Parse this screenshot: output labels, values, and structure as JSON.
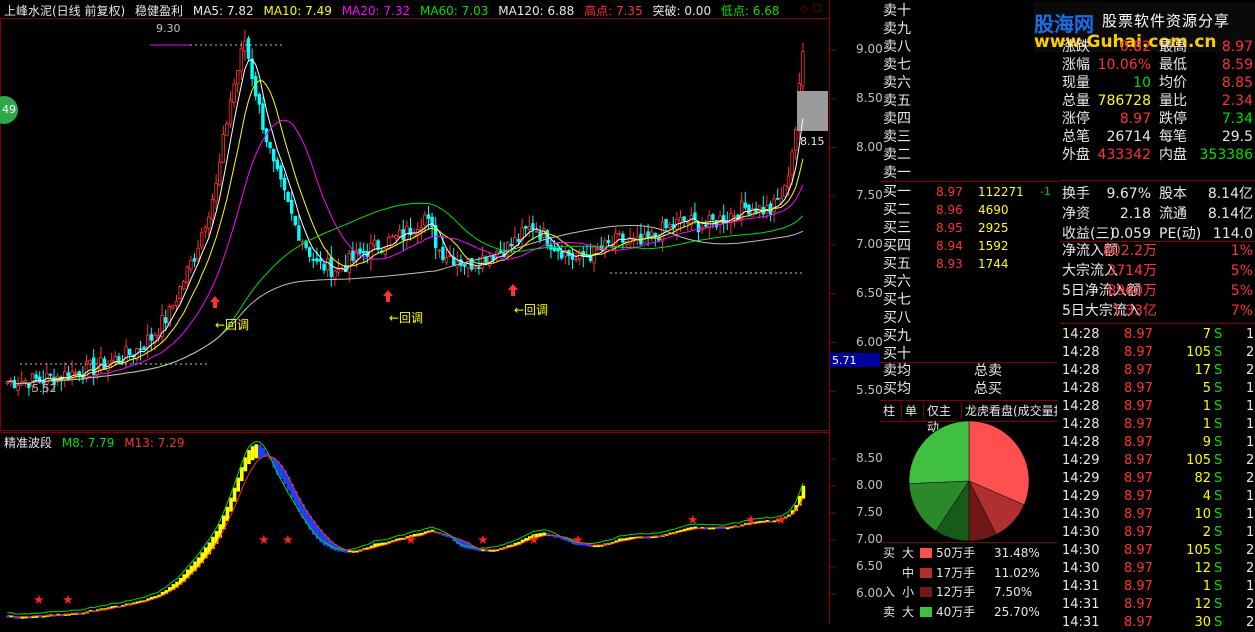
{
  "header": {
    "stock": "上峰水泥(日线 前复权)",
    "formula": "稳健盈利",
    "ma5": "MA5: 7.82",
    "ma10": "MA10: 7.49",
    "ma20": "MA20: 7.32",
    "ma60": "MA60: 7.03",
    "ma120": "MA120: 6.88",
    "high": "高点: 7.35",
    "breakout": "突破: 0.00",
    "low": "低点: 6.68",
    "badge": "49"
  },
  "colors": {
    "up": "#ff3232",
    "down": "#00ffff",
    "ma5": "#ffffff",
    "ma10": "#ffff00",
    "ma20": "#ff00ff",
    "ma60": "#00e000",
    "ma120": "#c0c0c0"
  },
  "main_axis": [
    "9.00",
    "8.50",
    "8.00",
    "7.50",
    "7.00",
    "6.50",
    "6.00",
    "5.50"
  ],
  "annotations": {
    "top": "9.30",
    "bottom": "5.52",
    "pullback": "←回调",
    "price_tag": "8.15",
    "low_tag": "5.71"
  },
  "sub": {
    "title": "精准波段",
    "m8": "M8: 7.79",
    "m13": "M13: 7.29",
    "axis": [
      "8.50",
      "8.00",
      "7.50",
      "7.00",
      "6.50",
      "6.00"
    ]
  },
  "order_book": {
    "asks": [
      "卖十",
      "卖九",
      "卖八",
      "卖七",
      "卖六",
      "卖五",
      "卖四",
      "卖三",
      "卖二",
      "卖一"
    ],
    "bids": [
      {
        "label": "买一",
        "price": "8.97",
        "vol": "112271",
        "chg": "-1"
      },
      {
        "label": "买二",
        "price": "8.96",
        "vol": "4690",
        "chg": ""
      },
      {
        "label": "买三",
        "price": "8.95",
        "vol": "2925",
        "chg": ""
      },
      {
        "label": "买四",
        "price": "8.94",
        "vol": "1592",
        "chg": ""
      },
      {
        "label": "买五",
        "price": "8.93",
        "vol": "1744",
        "chg": ""
      },
      {
        "label": "买六",
        "price": "",
        "vol": "",
        "chg": ""
      },
      {
        "label": "买七",
        "price": "",
        "vol": "",
        "chg": ""
      },
      {
        "label": "买八",
        "price": "",
        "vol": "",
        "chg": ""
      },
      {
        "label": "买九",
        "price": "",
        "vol": "",
        "chg": ""
      },
      {
        "label": "买十",
        "price": "",
        "vol": "",
        "chg": ""
      }
    ],
    "avg_sell": "卖均",
    "avg_buy": "买均",
    "total_sell": "总卖",
    "total_buy": "总买"
  },
  "logo": {
    "name": "股海网",
    "slogan": "股票软件资源分享",
    "url": "www.Guhai.com.cn"
  },
  "quote": [
    {
      "a": "涨跌",
      "av": "0.82",
      "ac": "red",
      "b": "最高",
      "bv": "8.97",
      "bc": "red"
    },
    {
      "a": "涨幅",
      "av": "10.06%",
      "ac": "red",
      "b": "最低",
      "bv": "8.59",
      "bc": "red"
    },
    {
      "a": "现量",
      "av": "10",
      "ac": "grn",
      "b": "均价",
      "bv": "8.85",
      "bc": "red"
    },
    {
      "a": "总量",
      "av": "786728",
      "ac": "yel",
      "b": "量比",
      "bv": "2.34",
      "bc": "red"
    },
    {
      "a": "涨停",
      "av": "8.97",
      "ac": "red",
      "b": "跌停",
      "bv": "7.34",
      "bc": "grn"
    },
    {
      "a": "总笔",
      "av": "26714",
      "ac": "wht",
      "b": "每笔",
      "bv": "29.5",
      "bc": "wht"
    },
    {
      "a": "外盘",
      "av": "433342",
      "ac": "red",
      "b": "内盘",
      "bv": "353386",
      "bc": "grn"
    },
    {
      "a": "换手",
      "av": "9.67%",
      "ac": "wht",
      "b": "股本",
      "bv": "8.14亿",
      "bc": "wht"
    },
    {
      "a": "净资",
      "av": "2.18",
      "ac": "wht",
      "b": "流通",
      "bv": "8.14亿",
      "bc": "wht"
    },
    {
      "a": "收益(三)",
      "av": "0.059",
      "ac": "wht",
      "b": "PE(动)",
      "bv": "114.0",
      "bc": "wht"
    },
    {
      "a": "净流入额",
      "av": "802.2万",
      "ac": "red",
      "b": "",
      "bv": "1%",
      "bc": "red"
    },
    {
      "a": "大宗流入",
      "av": "3714万",
      "ac": "red",
      "b": "",
      "bv": "5%",
      "bc": "red"
    },
    {
      "a": "5日净流入额",
      "av": "8960万",
      "ac": "red",
      "b": "",
      "bv": "5%",
      "bc": "red"
    },
    {
      "a": "5日大宗流入",
      "av": "1.33亿",
      "ac": "red",
      "b": "",
      "bv": "7%",
      "bc": "red"
    }
  ],
  "trades": [
    {
      "t": "14:28",
      "p": "8.97",
      "v": "7",
      "s": "S",
      "c": "1"
    },
    {
      "t": "14:28",
      "p": "8.97",
      "v": "105",
      "s": "S",
      "c": "2"
    },
    {
      "t": "14:28",
      "p": "8.97",
      "v": "17",
      "s": "S",
      "c": "2"
    },
    {
      "t": "14:28",
      "p": "8.97",
      "v": "5",
      "s": "S",
      "c": "1"
    },
    {
      "t": "14:28",
      "p": "8.97",
      "v": "1",
      "s": "S",
      "c": "1"
    },
    {
      "t": "14:28",
      "p": "8.97",
      "v": "1",
      "s": "S",
      "c": "1"
    },
    {
      "t": "14:28",
      "p": "8.97",
      "v": "9",
      "s": "S",
      "c": "1"
    },
    {
      "t": "14:29",
      "p": "8.97",
      "v": "105",
      "s": "S",
      "c": "2"
    },
    {
      "t": "14:29",
      "p": "8.97",
      "v": "82",
      "s": "S",
      "c": "2"
    },
    {
      "t": "14:29",
      "p": "8.97",
      "v": "4",
      "s": "S",
      "c": "1"
    },
    {
      "t": "14:30",
      "p": "8.97",
      "v": "10",
      "s": "S",
      "c": "1"
    },
    {
      "t": "14:30",
      "p": "8.97",
      "v": "2",
      "s": "S",
      "c": "1"
    },
    {
      "t": "14:30",
      "p": "8.97",
      "v": "105",
      "s": "S",
      "c": "2"
    },
    {
      "t": "14:30",
      "p": "8.97",
      "v": "12",
      "s": "S",
      "c": "2"
    },
    {
      "t": "14:31",
      "p": "8.97",
      "v": "1",
      "s": "S",
      "c": "1"
    },
    {
      "t": "14:31",
      "p": "8.97",
      "v": "12",
      "s": "S",
      "c": "2"
    },
    {
      "t": "14:31",
      "p": "8.97",
      "v": "30",
      "s": "S",
      "c": "2"
    }
  ],
  "tabs": [
    "柱",
    "单",
    "仅主动",
    "龙虎看盘(成交量按"
  ],
  "flow": {
    "buy_side": "买",
    "sell_side": "卖",
    "entry": "入",
    "rows": [
      {
        "side": "买",
        "size": "大",
        "color": "#ff5050",
        "amount": "50万手",
        "pct": "31.48%"
      },
      {
        "side": "",
        "size": "中",
        "color": "#b03030",
        "amount": "17万手",
        "pct": "11.02%"
      },
      {
        "side": "入",
        "size": "小",
        "color": "#701818",
        "amount": "12万手",
        "pct": "7.50%"
      },
      {
        "side": "卖",
        "size": "大",
        "color": "#40c040",
        "amount": "40万手",
        "pct": "25.70%"
      }
    ],
    "pie": [
      {
        "name": "大买",
        "value": 31.48,
        "color": "#ff5050"
      },
      {
        "name": "中买",
        "value": 11.02,
        "color": "#b03030"
      },
      {
        "name": "小买",
        "value": 7.5,
        "color": "#701818"
      },
      {
        "name": "小卖",
        "value": 9.3,
        "color": "#185a18"
      },
      {
        "name": "中卖",
        "value": 15.0,
        "color": "#2a8a2a"
      },
      {
        "name": "大卖",
        "value": 25.7,
        "color": "#40c040"
      }
    ]
  }
}
